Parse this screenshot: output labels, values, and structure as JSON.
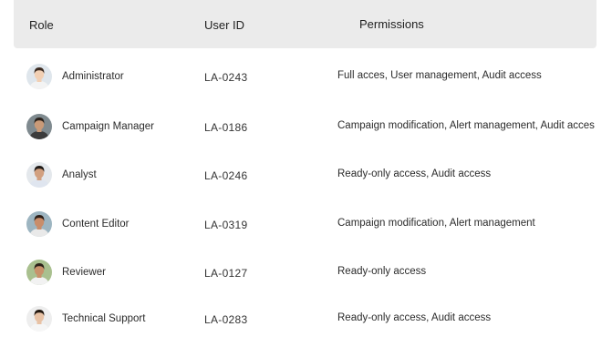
{
  "table": {
    "headers": {
      "role": "Role",
      "user_id": "User ID",
      "permissions": "Permissions"
    },
    "rows": [
      {
        "role": "Administrator",
        "user_id": "LA-0243",
        "permissions": "Full acces, User management, Audit access",
        "avatar": {
          "skin": "#f1cfb3",
          "hair": "#3b2a20",
          "bg": "#dfe6ec",
          "shirt": "#f3f3f3"
        }
      },
      {
        "role": "Campaign Manager",
        "user_id": "LA-0186",
        "permissions": "Campaign modification, Alert management, Audit acces",
        "avatar": {
          "skin": "#c99a78",
          "hair": "#2a211b",
          "bg": "#7f8a8f",
          "shirt": "#3c3c3c"
        }
      },
      {
        "role": "Analyst",
        "user_id": "LA-0246",
        "permissions": "Ready-only access, Audit access",
        "avatar": {
          "skin": "#d2a07f",
          "hair": "#1f1a17",
          "bg": "#e4e8ec",
          "shirt": "#dfe5ef"
        }
      },
      {
        "role": "Content Editor",
        "user_id": "LA-0319",
        "permissions": "Campaign modification, Alert management",
        "avatar": {
          "skin": "#c98d6a",
          "hair": "#2b1d16",
          "bg": "#9db5c1",
          "shirt": "#e9e9e9"
        }
      },
      {
        "role": "Reviewer",
        "user_id": "LA-0127",
        "permissions": "Ready-only access",
        "avatar": {
          "skin": "#c8926b",
          "hair": "#2c2118",
          "bg": "#a9c08f",
          "shirt": "#f2f2f2"
        }
      },
      {
        "role": "Technical Support",
        "user_id": "LA-0283",
        "permissions": "Ready-only access, Audit access",
        "avatar": {
          "skin": "#e8c2a5",
          "hair": "#23180f",
          "bg": "#eeeeee",
          "shirt": "#f6f6f6"
        }
      }
    ]
  }
}
